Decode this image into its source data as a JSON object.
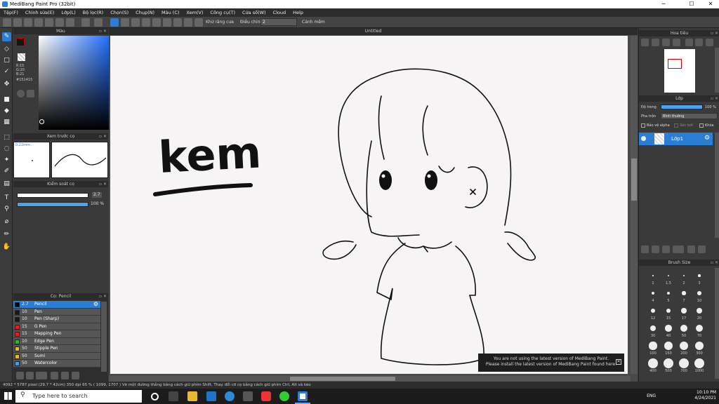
{
  "titlebar": {
    "title": "MediBang Paint Pro (32bit)",
    "min": "─",
    "max": "☐",
    "close": "✕"
  },
  "menu": [
    "Tệp(F)",
    "Chỉnh sửa(E)",
    "Lớp(L)",
    "Bộ lọc(R)",
    "Chọn(S)",
    "Chụp(N)",
    "Màu (C)",
    "Xem(V)",
    "Công cụ(T)",
    "Cửa số(W)",
    "Cloud",
    "Help"
  ],
  "toolbar": {
    "aa_label": "Khử răng cưa",
    "correction_label": "Điều chỉnh",
    "correction_value": "2",
    "snap_label": "Cảnh mềm"
  },
  "color_panel": {
    "title": "Màu",
    "r": "R:15",
    "g": "G:20",
    "b": "B:21",
    "hex": "#151415"
  },
  "brush_preview": {
    "title": "Xem trước cọ",
    "size": "0.22mm"
  },
  "brush_control": {
    "title": "Kiểm soát cọ",
    "size_value": "2.7",
    "opacity_value": "100 %"
  },
  "brush_list": {
    "title": "Cọ: Pencil",
    "items": [
      {
        "num": "2.7",
        "name": "Pencil",
        "color": "#000000"
      },
      {
        "num": "10",
        "name": "Pen",
        "color": "#1a1a1a"
      },
      {
        "num": "10",
        "name": "Pen (Sharp)",
        "color": "#1a1a1a"
      },
      {
        "num": "15",
        "name": "G Pen",
        "color": "#e02020"
      },
      {
        "num": "15",
        "name": "Mapping Pen",
        "color": "#e02020"
      },
      {
        "num": "10",
        "name": "Edge Pen",
        "color": "#20c020"
      },
      {
        "num": "50",
        "name": "Stipple Pen",
        "color": "#e0c020"
      },
      {
        "num": "50",
        "name": "Sumi",
        "color": "#e0c020"
      },
      {
        "num": "50",
        "name": "Watercolor",
        "color": "#40a0e0"
      }
    ]
  },
  "canvas": {
    "title": "Untitled",
    "handwriting": "kem"
  },
  "notice": {
    "line1": "You are not using the latest version of MediBang Paint.",
    "line2": "Please install the latest version of MediBang Paint found here.",
    "close": "✕"
  },
  "navigator": {
    "title": "Hoa tiêu"
  },
  "layers": {
    "title": "Lớp",
    "opacity_label": "Độ trong",
    "opacity_value": "100 %",
    "blend_label": "Pha trộn",
    "blend_value": "Bình thường",
    "protect_alpha": "Bảo vệ alpha",
    "clipping": "Xén bớt",
    "lock": "Khóa",
    "layer_name": "Lớp1"
  },
  "brush_size": {
    "title": "Brush Size",
    "labels": [
      "1",
      "1.5",
      "2",
      "3",
      "4",
      "5",
      "7",
      "10",
      "12",
      "15",
      "17",
      "20",
      "30",
      "40",
      "50",
      "70",
      "100",
      "150",
      "200",
      "300",
      "400",
      "500",
      "700",
      "1000"
    ]
  },
  "statusbar": "4092 * 5787 pixel  (29.7 * 42cm)  350 dpi  65 %  ( 1099, 1707 )  Vẽ một đường thẳng bằng cách giữ phím Shift, Thay đổi cỡ cọ bằng cách giữ phím Ctrl, Alt và kéo",
  "taskbar": {
    "search": "Type here to search",
    "lang": "ENG",
    "time": "10:10 PM",
    "date": "4/24/2021"
  }
}
